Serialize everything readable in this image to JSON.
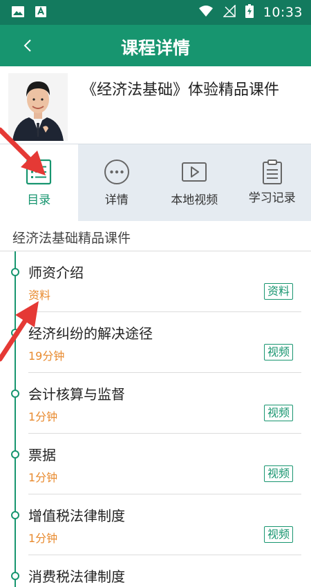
{
  "status_bar": {
    "time": "10:33"
  },
  "header": {
    "title": "课程详情"
  },
  "course": {
    "title": "《经济法基础》体验精品课件"
  },
  "tabs": [
    {
      "label": "目录",
      "icon": "list-icon",
      "active": true
    },
    {
      "label": "详情",
      "icon": "more-icon",
      "active": false
    },
    {
      "label": "本地视频",
      "icon": "play-icon",
      "active": false
    },
    {
      "label": "学习记录",
      "icon": "clipboard-icon",
      "active": false
    }
  ],
  "section": {
    "title": "经济法基础精品课件"
  },
  "lessons": [
    {
      "title": "师资介绍",
      "meta": "资料",
      "badge": "资料"
    },
    {
      "title": "经济纠纷的解决途径",
      "meta": "19分钟",
      "badge": "视频"
    },
    {
      "title": "会计核算与监督",
      "meta": "1分钟",
      "badge": "视频"
    },
    {
      "title": "票据",
      "meta": "1分钟",
      "badge": "视频"
    },
    {
      "title": "增值税法律制度",
      "meta": "1分钟",
      "badge": "视频"
    },
    {
      "title": "消费税法律制度",
      "meta": "",
      "badge": ""
    }
  ],
  "colors": {
    "primary": "#17956f",
    "status_bar": "#137a5e",
    "accent_orange": "#e88a2e",
    "arrow_red": "#e53935"
  }
}
